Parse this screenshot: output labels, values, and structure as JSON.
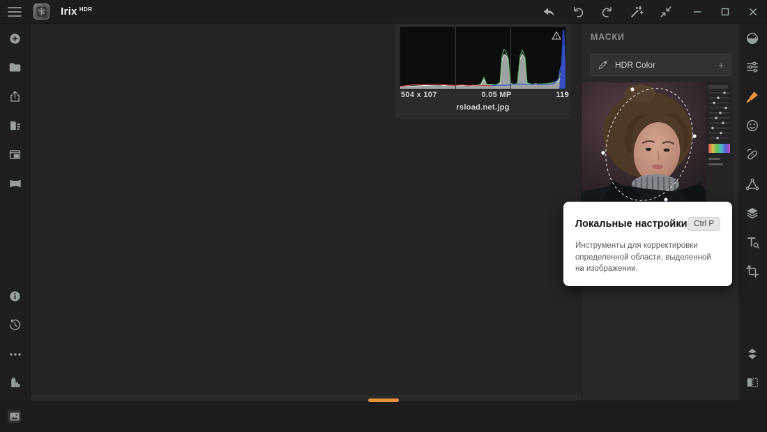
{
  "window": {
    "app_name": "Irix",
    "app_badge": "HDR"
  },
  "topbar": {
    "icons": [
      "hamburger-menu",
      "app-logo",
      "revert",
      "undo",
      "redo",
      "auto-enhance",
      "exit-fullscreen"
    ],
    "window_controls": [
      "minimize",
      "maximize",
      "close"
    ]
  },
  "left_toolbar": {
    "items": [
      "add-photo",
      "open-folder",
      "export",
      "batch-processing",
      "catalog",
      "panorama",
      "info",
      "history",
      "more-options",
      "film-roll"
    ]
  },
  "right_toolbar": {
    "items": [
      "filters",
      "adjustments",
      "local-adjustments",
      "portrait",
      "erase",
      "structure",
      "layers",
      "text",
      "crop",
      "flatten",
      "compare"
    ],
    "active_item": "local-adjustments"
  },
  "histogram_panel": {
    "dimensions": "504 x 107",
    "megapixels": "0.05 MP",
    "file_size": "119",
    "filename": "rsload.net.jpg",
    "channels": [
      "red",
      "green",
      "blue",
      "luminance"
    ],
    "has_clipping_warning": true
  },
  "masks_panel": {
    "title": "МАСКИ",
    "mask_type": "HDR Color",
    "add_label": "+"
  },
  "tooltip": {
    "title": "Локальные настройки",
    "shortcut": "Ctrl P",
    "description": "Инструменты для корректировки определенной области, выделенной на изображении."
  },
  "colors": {
    "accent_orange": "#e8923c",
    "topbar_bg": "#1d1d1d",
    "panel_bg": "#282828",
    "canvas_bg": "#242424",
    "tooltip_bg": "#ffffff",
    "histogram_red": "#c24036",
    "histogram_green": "#55b055",
    "histogram_blue": "#3c55d8"
  }
}
